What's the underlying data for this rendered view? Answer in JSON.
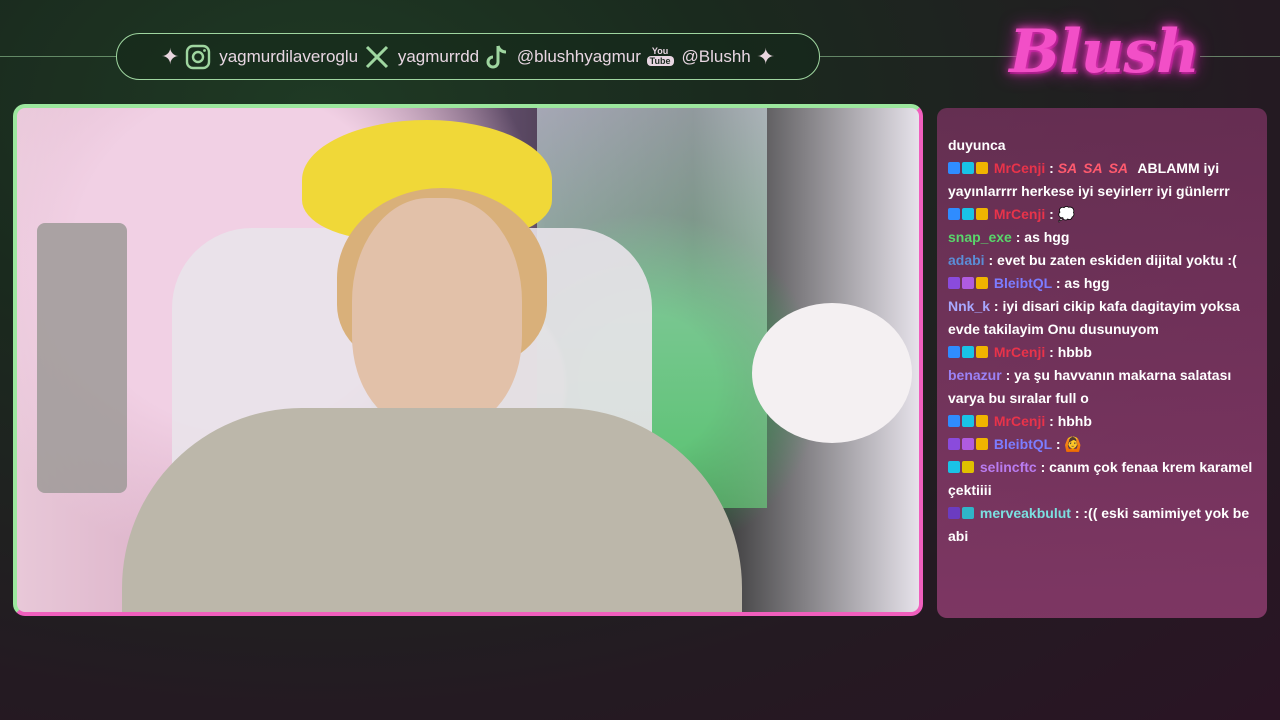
{
  "social": {
    "instagram": "yagmurdilaveroglu",
    "x": "yagmurrdd",
    "tiktok": "@blushhyagmur",
    "youtube_icon_top": "You",
    "youtube_icon_bottom": "Tube",
    "youtube": "@Blushh"
  },
  "brand": {
    "logo_text": "Blush"
  },
  "colors": {
    "accent_green": "#9ce79e",
    "accent_pink": "#f05fbd",
    "chat_bg": "#8a3f70"
  },
  "chat": {
    "messages": [
      {
        "name": "",
        "color": "#ffffff",
        "badges": [],
        "text": "duyunca"
      },
      {
        "name": "MrCenji",
        "color": "#e8334a",
        "badges": [
          "#2f8cff",
          "#19c3e6",
          "#f0b400"
        ],
        "emotes": [
          "SA",
          "SA",
          "SA"
        ],
        "text": "ABLAMM iyi yayınlarrrr herkese iyi seyirlerr iyi günlerrr"
      },
      {
        "name": "MrCenji",
        "color": "#e8334a",
        "badges": [
          "#2f8cff",
          "#19c3e6",
          "#f0b400"
        ],
        "text": "💭"
      },
      {
        "name": "snap_exe",
        "color": "#59d66b",
        "badges": [],
        "text": "as hgg"
      },
      {
        "name": "adabi",
        "color": "#5b8dd6",
        "badges": [],
        "text": "evet bu zaten eskiden dijital yoktu :("
      },
      {
        "name": "BleibtQL",
        "color": "#7c7cff",
        "badges": [
          "#8a4bdc",
          "#b05be0",
          "#f0b400"
        ],
        "text": "as hgg"
      },
      {
        "name": "Nnk_k",
        "color": "#a8a8ff",
        "badges": [],
        "text": "iyi disari cikip kafa dagitayim yoksa evde takilayim Onu dusunuyom"
      },
      {
        "name": "MrCenji",
        "color": "#e8334a",
        "badges": [
          "#2f8cff",
          "#19c3e6",
          "#f0b400"
        ],
        "text": "hbbb"
      },
      {
        "name": "benazur",
        "color": "#9b82f5",
        "badges": [],
        "text": "ya şu havvanın makarna salatası varya bu sıralar full o"
      },
      {
        "name": "MrCenji",
        "color": "#e8334a",
        "badges": [
          "#2f8cff",
          "#19c3e6",
          "#f0b400"
        ],
        "text": "hbhb"
      },
      {
        "name": "BleibtQL",
        "color": "#7c7cff",
        "badges": [
          "#8a4bdc",
          "#b05be0",
          "#f0b400"
        ],
        "text": "🙆"
      },
      {
        "name": "selincftc",
        "color": "#b97cf0",
        "badges": [
          "#19c3e6",
          "#e0c000"
        ],
        "text": "canım çok fenaa krem karamel çektiiii"
      },
      {
        "name": "merveakbulut",
        "color": "#7be0e0",
        "badges": [
          "#6b3cc0",
          "#2fb5c8"
        ],
        "text": ":(( eski samimiyet yok be abi"
      }
    ]
  }
}
